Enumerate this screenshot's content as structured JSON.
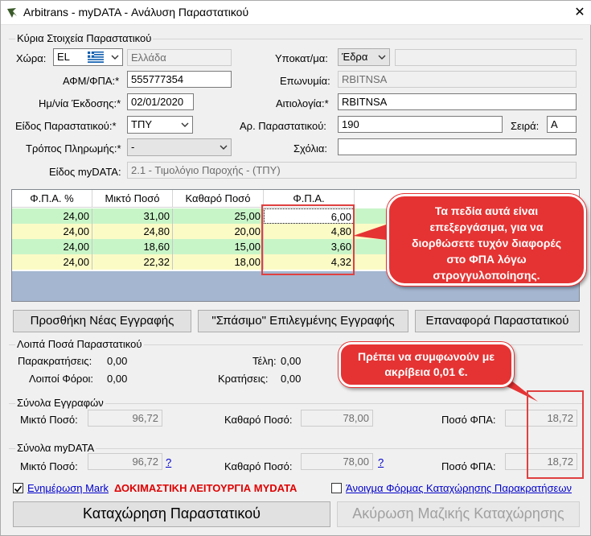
{
  "window": {
    "title": "Arbitrans - myDATA - Ανάλυση Παραστατικού",
    "close": "✕"
  },
  "main_group": {
    "label": "Κύρια Στοιχεία Παραστατικού",
    "country_label": "Χώρα:",
    "country_code": "EL",
    "country_name": "Ελλάδα",
    "afm_label": "ΑΦΜ/ΦΠΑ:*",
    "afm_value": "555777354",
    "date_label": "Ημ/νία Έκδοσης:*",
    "date_value": "02/01/2020",
    "doctype_label": "Είδος Παραστατικού:*",
    "doctype_value": "ΤΠΥ",
    "payment_label": "Τρόπος Πληρωμής:*",
    "payment_value": "-",
    "mydata_type_label": "Είδος myDATA:",
    "mydata_type_value": "2.1 - Τιμολόγιο Παροχής - (ΤΠΥ)",
    "branch_label": "Υποκατ/μα:",
    "branch_value": "Έδρα",
    "branch_extra": "",
    "name_label": "Επωνυμία:",
    "name_value": "RBITNSA",
    "reason_label": "Αιτιολογία:*",
    "reason_value": "RBITNSA",
    "docnum_label": "Αρ. Παραστατικού:",
    "docnum_value": "190",
    "series_label": "Σειρά:",
    "series_value": "A",
    "comments_label": "Σχόλια:",
    "comments_value": ""
  },
  "grid": {
    "headers": [
      "Φ.Π.Α. %",
      "Μικτό Ποσό",
      "Καθαρό Ποσό",
      "Φ.Π.Α."
    ],
    "rows": [
      {
        "vat_pct": "24,00",
        "gross": "31,00",
        "net": "25,00",
        "vat": "6,00"
      },
      {
        "vat_pct": "24,00",
        "gross": "24,80",
        "net": "20,00",
        "vat": "4,80"
      },
      {
        "vat_pct": "24,00",
        "gross": "18,60",
        "net": "15,00",
        "vat": "3,60"
      },
      {
        "vat_pct": "24,00",
        "gross": "22,32",
        "net": "18,00",
        "vat": "4,32"
      }
    ]
  },
  "callouts": {
    "editable": "Τα πεδία αυτά είναι επεξεργάσιμα, για να διορθώσετε τυχόν διαφορές στο ΦΠΑ λόγω στρογγυλοποίησης.",
    "match": "Πρέπει να συμφωνούν με ακρίβεια 0,01 €."
  },
  "buttons": {
    "add": "Προσθήκη Νέας Εγγραφής",
    "split": "\"Σπάσιμο\" Επιλεγμένης Εγγραφής",
    "restore": "Επαναφορά Παραστατικού",
    "submit": "Καταχώρηση Παραστατικού",
    "cancel_batch": "Ακύρωση Μαζικής Καταχώρησης"
  },
  "other_amounts": {
    "label": "Λοιπά Ποσά Παραστατικού",
    "withholding_label": "Παρακρατήσεις:",
    "withholding_value": "0,00",
    "other_taxes_label": "Λοιποί Φόροι:",
    "other_taxes_value": "0,00",
    "fees_label": "Τέλη:",
    "fees_value": "0,00",
    "deductions_label": "Κρατήσεις:",
    "deductions_value": "0,00"
  },
  "totals_records": {
    "label": "Σύνολα Εγγραφών",
    "gross_label": "Μικτό Ποσό:",
    "gross_value": "96,72",
    "net_label": "Καθαρό Ποσό:",
    "net_value": "78,00",
    "vat_label": "Ποσό ΦΠΑ:",
    "vat_value": "18,72"
  },
  "totals_mydata": {
    "label": "Σύνολα myDATA",
    "gross_label": "Μικτό Ποσό:",
    "gross_value": "96,72",
    "net_label": "Καθαρό Ποσό:",
    "net_value": "78,00",
    "vat_label": "Ποσό ΦΠΑ:",
    "vat_value": "18,72",
    "help": "?"
  },
  "footer": {
    "update_mark": "Ενημέρωση Mark",
    "test_mode": "ΔΟΚΙΜΑΣΤΙΚΗ ΛΕΙΤΟΥΡΓΙΑ MYDATA",
    "open_withholding": "Άνοιγμα Φόρμας Καταχώρησης Παρακρατήσεων"
  },
  "colors": {
    "accent_red": "#e53333",
    "green_row": "#c8f5c8",
    "yellow_row": "#fbfbc6",
    "empty_grid": "#a4b6d0"
  }
}
